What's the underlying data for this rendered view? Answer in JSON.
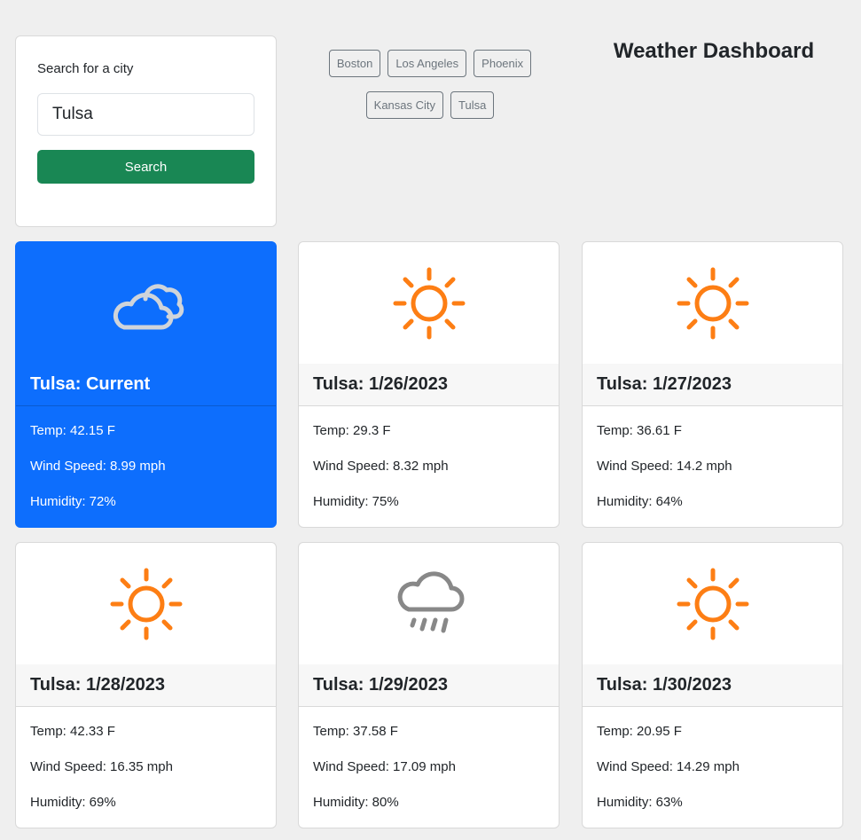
{
  "search": {
    "label": "Search for a city",
    "value": "Tulsa",
    "button_label": "Search"
  },
  "history": [
    "Boston",
    "Los Angeles",
    "Phoenix",
    "Kansas City",
    "Tulsa"
  ],
  "title": "Weather Dashboard",
  "colors": {
    "current_card": "#0d6efd",
    "search_button": "#198754",
    "sun_icon": "#fd7e14",
    "cloud_icon": "#cfd4da",
    "rain_icon": "#888888"
  },
  "cards": [
    {
      "header": "Tulsa: Current",
      "icon": "cloud-icon",
      "temp": "Temp: 42.15 F",
      "wind": "Wind Speed: 8.99 mph",
      "humidity": "Humidity: 72%"
    },
    {
      "header": "Tulsa: 1/26/2023",
      "icon": "sun-icon",
      "temp": "Temp: 29.3 F",
      "wind": "Wind Speed: 8.32 mph",
      "humidity": "Humidity: 75%"
    },
    {
      "header": "Tulsa: 1/27/2023",
      "icon": "sun-icon",
      "temp": "Temp: 36.61 F",
      "wind": "Wind Speed: 14.2 mph",
      "humidity": "Humidity: 64%"
    },
    {
      "header": "Tulsa: 1/28/2023",
      "icon": "sun-icon",
      "temp": "Temp: 42.33 F",
      "wind": "Wind Speed: 16.35 mph",
      "humidity": "Humidity: 69%"
    },
    {
      "header": "Tulsa: 1/29/2023",
      "icon": "rain-icon",
      "temp": "Temp: 37.58 F",
      "wind": "Wind Speed: 17.09 mph",
      "humidity": "Humidity: 80%"
    },
    {
      "header": "Tulsa: 1/30/2023",
      "icon": "sun-icon",
      "temp": "Temp: 20.95 F",
      "wind": "Wind Speed: 14.29 mph",
      "humidity": "Humidity: 63%"
    }
  ]
}
